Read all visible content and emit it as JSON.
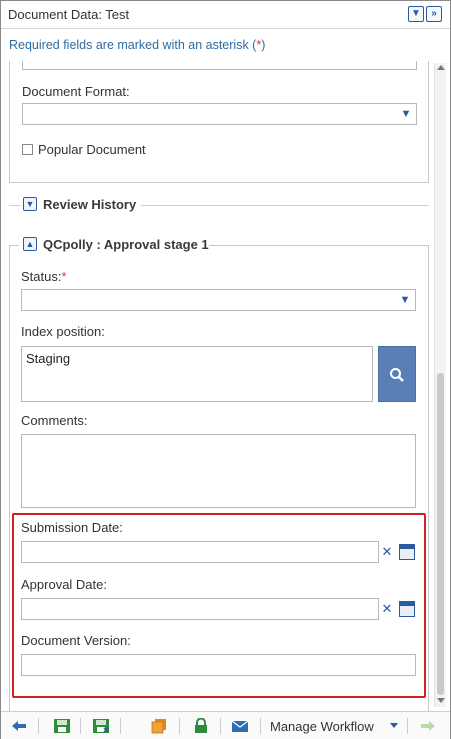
{
  "panel": {
    "title": "Document Data: Test",
    "filter_icon": "filter-icon",
    "expand_icon": "double-chevron-right-icon"
  },
  "required_note": {
    "text": "Required fields are marked with an asterisk (",
    "star": "*",
    "end": ")"
  },
  "document_section": {
    "format_label": "Document Format:",
    "format_value": "",
    "popular_label": "Popular Document",
    "popular_checked": false
  },
  "review_history": {
    "label": "Review History",
    "expanded": false
  },
  "approval_stage": {
    "label": "QCpolly : Approval stage 1",
    "expanded": true,
    "status_label": "Status:",
    "status_required": "*",
    "status_value": "",
    "index_label": "Index position:",
    "index_value": "Staging",
    "comments_label": "Comments:",
    "comments_value": "",
    "submission_label": "Submission Date:",
    "submission_value": "",
    "approval_label": "Approval Date:",
    "approval_value": "",
    "version_label": "Document Version:",
    "version_value": ""
  },
  "footer": {
    "manage_workflow": "Manage Workflow",
    "icons": [
      "back-arrow-icon",
      "save-icon",
      "save-close-icon",
      "copy-icon",
      "lock-icon",
      "email-icon",
      "forward-arrow-icon"
    ]
  },
  "colors": {
    "accent": "#2c5aa0",
    "required": "#d33333",
    "highlight": "#d32020"
  }
}
